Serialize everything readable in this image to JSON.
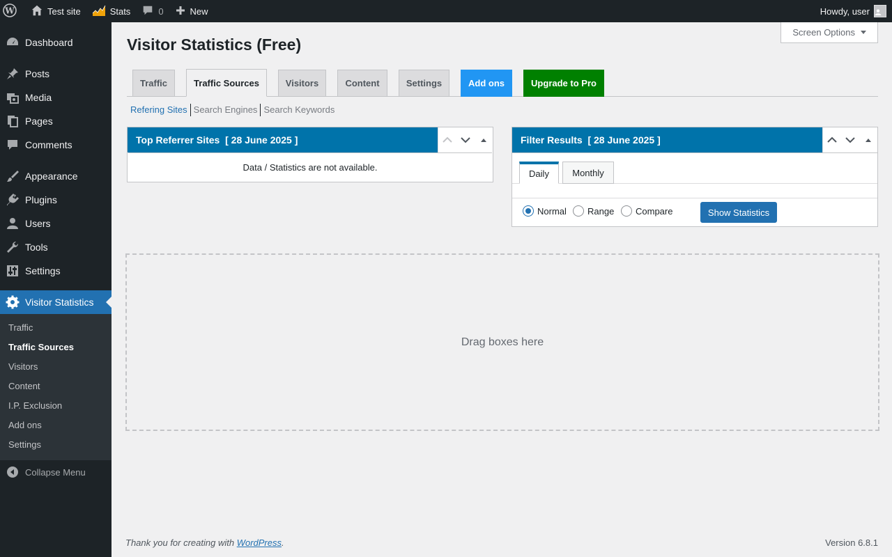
{
  "adminbar": {
    "site_name": "Test site",
    "stats": "Stats",
    "comments_count": "0",
    "new": "New",
    "howdy": "Howdy, user"
  },
  "sidebar": {
    "items": [
      {
        "label": "Dashboard",
        "icon": "dashboard-icon"
      },
      {
        "label": "Posts",
        "icon": "pin-icon"
      },
      {
        "label": "Media",
        "icon": "media-icon"
      },
      {
        "label": "Pages",
        "icon": "pages-icon"
      },
      {
        "label": "Comments",
        "icon": "comment-icon"
      },
      {
        "label": "Appearance",
        "icon": "brush-icon"
      },
      {
        "label": "Plugins",
        "icon": "plug-icon"
      },
      {
        "label": "Users",
        "icon": "user-icon"
      },
      {
        "label": "Tools",
        "icon": "wrench-icon"
      },
      {
        "label": "Settings",
        "icon": "sliders-icon"
      },
      {
        "label": "Visitor Statistics",
        "icon": "gear-icon"
      }
    ],
    "submenu": [
      "Traffic",
      "Traffic Sources",
      "Visitors",
      "Content",
      "I.P. Exclusion",
      "Add ons",
      "Settings"
    ],
    "collapse": "Collapse Menu"
  },
  "screen_options": "Screen Options",
  "page_title": "Visitor Statistics (Free)",
  "tabs": [
    "Traffic",
    "Traffic Sources",
    "Visitors",
    "Content",
    "Settings",
    "Add ons",
    "Upgrade to Pro"
  ],
  "subnav": [
    "Refering Sites",
    "Search Engines",
    "Search Keywords"
  ],
  "referrer_box": {
    "title": "Top Referrer Sites  [ 28 June 2025 ]",
    "empty": "Data / Statistics are not available."
  },
  "filter_box": {
    "title": "Filter Results  [ 28 June 2025 ]",
    "tabs": [
      "Daily",
      "Monthly"
    ],
    "radios": [
      "Normal",
      "Range",
      "Compare"
    ],
    "button": "Show Statistics"
  },
  "drop_area": "Drag boxes here",
  "footer": {
    "thanks": "Thank you for creating with ",
    "link": "WordPress",
    "period": ".",
    "version": "Version 6.8.1"
  },
  "colors": {
    "accent": "#2271b1",
    "postbox_header": "#0073aa",
    "addons_tab": "#2196f3",
    "upgrade_tab": "#008000",
    "stats_icon": "#f0a30a"
  }
}
